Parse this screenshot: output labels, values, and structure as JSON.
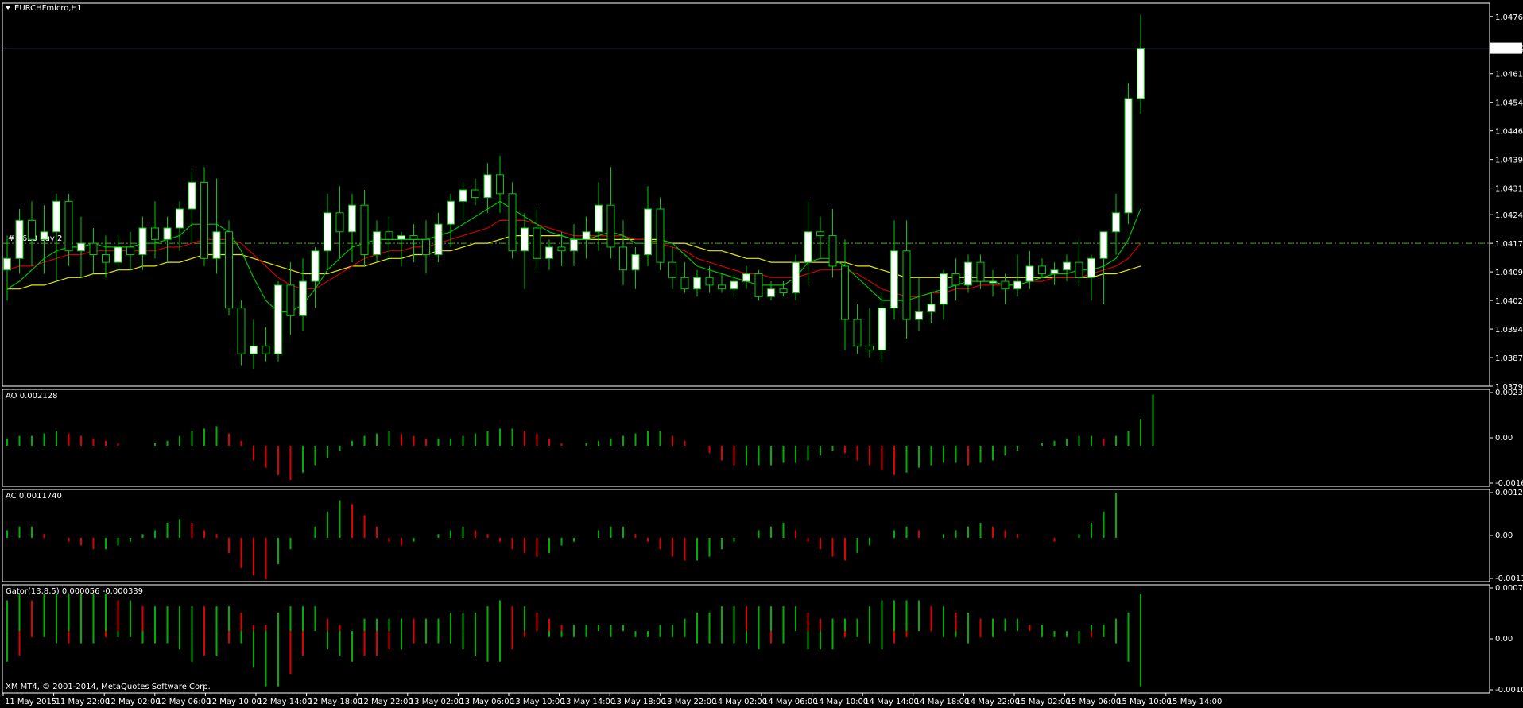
{
  "window": {
    "symbol_title": "EURCHFmicro,H1",
    "copyright": "XM MT4, © 2001-2014, MetaQuotes Software Corp.",
    "order_label": "#  2628  buy  2"
  },
  "colors": {
    "background": "#000000",
    "grid_frame": "#ffffff",
    "bull_body": "#ffffff",
    "wick": "#00cc00",
    "ma_green": "#00c000",
    "ma_red": "#d00000",
    "ma_yellow": "#e8e800",
    "hist_up": "#00b000",
    "hist_down": "#e00000",
    "order_line": "#4cb000",
    "current_price_line": "#a0a8c0"
  },
  "price_axis": {
    "ticks": [
      "1.04765",
      "1.04615",
      "1.04540",
      "1.04465",
      "1.04390",
      "1.04315",
      "1.04245",
      "1.04170",
      "1.04095",
      "1.04020",
      "1.03945",
      "1.03870",
      "1.03795"
    ],
    "current_price": "1.04682",
    "order_price": "1.04170"
  },
  "time_axis": {
    "labels": [
      "11 May 2015",
      "11 May 22:00",
      "12 May 02:00",
      "12 May 06:00",
      "12 May 10:00",
      "12 May 14:00",
      "12 May 18:00",
      "12 May 22:00",
      "13 May 02:00",
      "13 May 06:00",
      "13 May 10:00",
      "13 May 14:00",
      "13 May 18:00",
      "13 May 22:00",
      "14 May 02:00",
      "14 May 06:00",
      "14 May 10:00",
      "14 May 14:00",
      "14 May 18:00",
      "14 May 22:00",
      "15 May 02:00",
      "15 May 06:00",
      "15 May 10:00",
      "15 May 14:00"
    ]
  },
  "panels": {
    "ao": {
      "label": "AO 0.002128",
      "ticks": [
        "0.002309",
        "0.00",
        "-0.001661"
      ]
    },
    "ac": {
      "label": "AC 0.0011740",
      "ticks": [
        "0.001285",
        "0.00",
        "-0.001161"
      ]
    },
    "gator": {
      "label": "Gator(13,8,5) 0.000056 -0.000339",
      "ticks": [
        "0.000752",
        "0.00",
        "-0.001008"
      ]
    }
  },
  "chart_data": {
    "type": "candlestick",
    "title": "EURCHFmicro,H1",
    "timeframe": "H1",
    "ylim": [
      1.03795,
      1.048
    ],
    "candles": [
      [
        1.041,
        1.0419,
        1.0402,
        1.0413
      ],
      [
        1.0413,
        1.0426,
        1.0409,
        1.0423
      ],
      [
        1.0423,
        1.0428,
        1.0411,
        1.0418
      ],
      [
        1.0418,
        1.0427,
        1.0409,
        1.042
      ],
      [
        1.042,
        1.043,
        1.0407,
        1.0428
      ],
      [
        1.0428,
        1.043,
        1.0411,
        1.0415
      ],
      [
        1.0415,
        1.0424,
        1.0408,
        1.0417
      ],
      [
        1.0417,
        1.0421,
        1.0409,
        1.0414
      ],
      [
        1.0414,
        1.0419,
        1.0408,
        1.0412
      ],
      [
        1.0412,
        1.0419,
        1.041,
        1.0416
      ],
      [
        1.0416,
        1.042,
        1.041,
        1.0414
      ],
      [
        1.0414,
        1.0424,
        1.041,
        1.0421
      ],
      [
        1.0421,
        1.0428,
        1.0413,
        1.0418
      ],
      [
        1.0418,
        1.0424,
        1.0412,
        1.0421
      ],
      [
        1.0421,
        1.0428,
        1.0415,
        1.0426
      ],
      [
        1.0426,
        1.0436,
        1.0417,
        1.0433
      ],
      [
        1.0433,
        1.0437,
        1.0411,
        1.0413
      ],
      [
        1.0413,
        1.0434,
        1.0409,
        1.042
      ],
      [
        1.042,
        1.0423,
        1.0398,
        1.04
      ],
      [
        1.04,
        1.0402,
        1.0385,
        1.0388
      ],
      [
        1.0388,
        1.0397,
        1.0384,
        1.039
      ],
      [
        1.039,
        1.0395,
        1.0386,
        1.0388
      ],
      [
        1.0388,
        1.0407,
        1.0386,
        1.0406
      ],
      [
        1.0406,
        1.0412,
        1.0393,
        1.0398
      ],
      [
        1.0398,
        1.0413,
        1.0394,
        1.0407
      ],
      [
        1.0407,
        1.0416,
        1.04,
        1.0415
      ],
      [
        1.0415,
        1.043,
        1.041,
        1.0425
      ],
      [
        1.0425,
        1.0432,
        1.0413,
        1.042
      ],
      [
        1.042,
        1.043,
        1.0412,
        1.0427
      ],
      [
        1.0427,
        1.0431,
        1.0411,
        1.0414
      ],
      [
        1.0414,
        1.0423,
        1.0412,
        1.042
      ],
      [
        1.042,
        1.0424,
        1.0412,
        1.0418
      ],
      [
        1.0418,
        1.042,
        1.0411,
        1.0419
      ],
      [
        1.0419,
        1.0422,
        1.0412,
        1.0418
      ],
      [
        1.0418,
        1.0423,
        1.0409,
        1.0414
      ],
      [
        1.0414,
        1.0425,
        1.0412,
        1.0422
      ],
      [
        1.0422,
        1.043,
        1.0416,
        1.0428
      ],
      [
        1.0428,
        1.0433,
        1.0423,
        1.0431
      ],
      [
        1.0431,
        1.0434,
        1.0427,
        1.0429
      ],
      [
        1.0429,
        1.0438,
        1.0425,
        1.0435
      ],
      [
        1.0435,
        1.044,
        1.0425,
        1.043
      ],
      [
        1.043,
        1.0433,
        1.0413,
        1.0415
      ],
      [
        1.0415,
        1.0425,
        1.0405,
        1.0421
      ],
      [
        1.0421,
        1.0426,
        1.041,
        1.0413
      ],
      [
        1.0413,
        1.0418,
        1.041,
        1.0416
      ],
      [
        1.0416,
        1.042,
        1.0411,
        1.0415
      ],
      [
        1.0415,
        1.0422,
        1.0411,
        1.0418
      ],
      [
        1.0418,
        1.0424,
        1.0413,
        1.042
      ],
      [
        1.042,
        1.0433,
        1.0415,
        1.0427
      ],
      [
        1.0427,
        1.0437,
        1.0413,
        1.0416
      ],
      [
        1.0416,
        1.0423,
        1.0406,
        1.041
      ],
      [
        1.041,
        1.0416,
        1.0405,
        1.0414
      ],
      [
        1.0414,
        1.0432,
        1.0411,
        1.0426
      ],
      [
        1.0426,
        1.0429,
        1.041,
        1.0412
      ],
      [
        1.0412,
        1.0416,
        1.0405,
        1.0408
      ],
      [
        1.0408,
        1.0412,
        1.0404,
        1.0405
      ],
      [
        1.0405,
        1.041,
        1.0403,
        1.0408
      ],
      [
        1.0408,
        1.0411,
        1.0404,
        1.0406
      ],
      [
        1.0406,
        1.0409,
        1.0404,
        1.0405
      ],
      [
        1.0405,
        1.0409,
        1.0403,
        1.0407
      ],
      [
        1.0407,
        1.0411,
        1.0405,
        1.0409
      ],
      [
        1.0409,
        1.041,
        1.0402,
        1.0403
      ],
      [
        1.0403,
        1.0407,
        1.0402,
        1.0405
      ],
      [
        1.0405,
        1.0407,
        1.0403,
        1.0404
      ],
      [
        1.0404,
        1.0414,
        1.0402,
        1.0412
      ],
      [
        1.0412,
        1.0428,
        1.0406,
        1.042
      ],
      [
        1.042,
        1.0424,
        1.0413,
        1.0419
      ],
      [
        1.0419,
        1.0426,
        1.0408,
        1.0411
      ],
      [
        1.0411,
        1.0418,
        1.0389,
        1.0397
      ],
      [
        1.0397,
        1.0401,
        1.0388,
        1.039
      ],
      [
        1.039,
        1.04,
        1.0387,
        1.0389
      ],
      [
        1.0389,
        1.0404,
        1.0386,
        1.04
      ],
      [
        1.04,
        1.0423,
        1.0397,
        1.0415
      ],
      [
        1.0415,
        1.0423,
        1.0392,
        1.0397
      ],
      [
        1.0397,
        1.0408,
        1.0394,
        1.0399
      ],
      [
        1.0399,
        1.0404,
        1.0396,
        1.0401
      ],
      [
        1.0401,
        1.041,
        1.0397,
        1.0409
      ],
      [
        1.0409,
        1.0413,
        1.0402,
        1.0406
      ],
      [
        1.0406,
        1.0414,
        1.0404,
        1.0412
      ],
      [
        1.0412,
        1.0414,
        1.0405,
        1.0407
      ],
      [
        1.0407,
        1.041,
        1.0403,
        1.0407
      ],
      [
        1.0407,
        1.0409,
        1.0401,
        1.0405
      ],
      [
        1.0405,
        1.0414,
        1.0403,
        1.0407
      ],
      [
        1.0407,
        1.0415,
        1.0405,
        1.0411
      ],
      [
        1.0411,
        1.0413,
        1.0408,
        1.0409
      ],
      [
        1.0409,
        1.0412,
        1.0406,
        1.041
      ],
      [
        1.041,
        1.0414,
        1.0407,
        1.0412
      ],
      [
        1.0412,
        1.0418,
        1.0406,
        1.0408
      ],
      [
        1.0408,
        1.0414,
        1.0402,
        1.0413
      ],
      [
        1.0413,
        1.042,
        1.0401,
        1.042
      ],
      [
        1.042,
        1.043,
        1.0414,
        1.0425
      ],
      [
        1.0425,
        1.0459,
        1.0422,
        1.0455
      ],
      [
        1.0455,
        1.0477,
        1.0451,
        1.0468
      ]
    ],
    "ma_green": [
      1.0405,
      1.0407,
      1.041,
      1.0413,
      1.0415,
      1.0416,
      1.0416,
      1.0417,
      1.0416,
      1.0416,
      1.0416,
      1.0417,
      1.0417,
      1.0418,
      1.0419,
      1.0422,
      1.0422,
      1.0422,
      1.042,
      1.0415,
      1.0408,
      1.0402,
      1.0399,
      1.0399,
      1.0401,
      1.0405,
      1.041,
      1.0413,
      1.0416,
      1.0417,
      1.0418,
      1.0418,
      1.0418,
      1.0418,
      1.0418,
      1.0419,
      1.042,
      1.0422,
      1.0424,
      1.0426,
      1.0428,
      1.0426,
      1.0424,
      1.0422,
      1.042,
      1.0419,
      1.0418,
      1.0418,
      1.0419,
      1.042,
      1.0419,
      1.0417,
      1.0417,
      1.0418,
      1.0417,
      1.0414,
      1.0411,
      1.041,
      1.0409,
      1.0408,
      1.0407,
      1.0406,
      1.0406,
      1.0406,
      1.0408,
      1.0412,
      1.0413,
      1.0413,
      1.0411,
      1.0408,
      1.0405,
      1.0402,
      1.0402,
      1.0402,
      1.0403,
      1.0404,
      1.0405,
      1.0406,
      1.0407,
      1.0407,
      1.0407,
      1.0406,
      1.0406,
      1.0407,
      1.0408,
      1.0409,
      1.0409,
      1.041,
      1.041,
      1.0411,
      1.0413,
      1.0418,
      1.0426
    ],
    "ma_red": [
      1.041,
      1.0411,
      1.0411,
      1.0412,
      1.0413,
      1.0414,
      1.0414,
      1.0415,
      1.0415,
      1.0415,
      1.0415,
      1.0415,
      1.0415,
      1.0416,
      1.0416,
      1.0417,
      1.0418,
      1.0418,
      1.0418,
      1.0417,
      1.0414,
      1.0411,
      1.0408,
      1.0406,
      1.0405,
      1.0405,
      1.0407,
      1.0409,
      1.0411,
      1.0413,
      1.0414,
      1.0415,
      1.0415,
      1.0416,
      1.0416,
      1.0417,
      1.0418,
      1.0419,
      1.042,
      1.0421,
      1.0423,
      1.0423,
      1.0423,
      1.0422,
      1.0421,
      1.042,
      1.0419,
      1.0419,
      1.0419,
      1.0419,
      1.0419,
      1.0418,
      1.0418,
      1.0417,
      1.0416,
      1.0415,
      1.0413,
      1.0412,
      1.0411,
      1.041,
      1.0409,
      1.0409,
      1.0408,
      1.0408,
      1.0408,
      1.0409,
      1.041,
      1.041,
      1.041,
      1.0409,
      1.0407,
      1.0405,
      1.0404,
      1.0403,
      1.0403,
      1.0404,
      1.0404,
      1.0405,
      1.0405,
      1.0406,
      1.0406,
      1.0406,
      1.0406,
      1.0407,
      1.0407,
      1.0408,
      1.0408,
      1.0408,
      1.0409,
      1.041,
      1.0411,
      1.0413,
      1.0417
    ],
    "ma_yellow": [
      1.0405,
      1.0405,
      1.0406,
      1.0406,
      1.0407,
      1.0408,
      1.0408,
      1.0409,
      1.0409,
      1.041,
      1.041,
      1.0411,
      1.0411,
      1.0412,
      1.0412,
      1.0413,
      1.0414,
      1.0414,
      1.0414,
      1.0414,
      1.0413,
      1.0412,
      1.0411,
      1.041,
      1.0409,
      1.0409,
      1.0409,
      1.041,
      1.0411,
      1.0411,
      1.0412,
      1.0413,
      1.0413,
      1.0414,
      1.0414,
      1.0415,
      1.0415,
      1.0416,
      1.0417,
      1.0417,
      1.0418,
      1.0419,
      1.0419,
      1.0419,
      1.0419,
      1.0419,
      1.0418,
      1.0418,
      1.0418,
      1.0418,
      1.0418,
      1.0418,
      1.0418,
      1.0418,
      1.0417,
      1.0417,
      1.0416,
      1.0415,
      1.0415,
      1.0414,
      1.0413,
      1.0413,
      1.0412,
      1.0412,
      1.0412,
      1.0412,
      1.0412,
      1.0412,
      1.0412,
      1.0411,
      1.0411,
      1.041,
      1.0409,
      1.0408,
      1.0408,
      1.0408,
      1.0408,
      1.0408,
      1.0408,
      1.0408,
      1.0408,
      1.0408,
      1.0408,
      1.0408,
      1.0408,
      1.0408,
      1.0408,
      1.0408,
      1.0408,
      1.0409,
      1.0409,
      1.041,
      1.0411
    ],
    "ao": [
      0.0003,
      0.0004,
      0.0004,
      0.0005,
      0.0006,
      0.0005,
      0.0004,
      0.0003,
      0.0002,
      0.0001,
      0.0,
      0.0,
      0.0001,
      0.0002,
      0.0004,
      0.0006,
      0.0007,
      0.0008,
      0.0005,
      0.0002,
      -0.0006,
      -0.0009,
      -0.0012,
      -0.0014,
      -0.0011,
      -0.0008,
      -0.0005,
      -0.0002,
      0.0002,
      0.0004,
      0.0005,
      0.0006,
      0.0005,
      0.0004,
      0.0003,
      0.0003,
      0.0003,
      0.0004,
      0.0005,
      0.0006,
      0.0007,
      0.0007,
      0.0006,
      0.0005,
      0.0003,
      0.0001,
      0.0,
      0.0001,
      0.0002,
      0.0003,
      0.0004,
      0.0005,
      0.0006,
      0.0006,
      0.0004,
      0.0002,
      0.0,
      -0.0003,
      -0.0006,
      -0.0008,
      -0.0008,
      -0.0008,
      -0.0008,
      -0.0007,
      -0.0007,
      -0.0006,
      -0.0004,
      -0.0002,
      -0.0003,
      -0.0006,
      -0.0008,
      -0.001,
      -0.0012,
      -0.0011,
      -0.0009,
      -0.0008,
      -0.0007,
      -0.0007,
      -0.0008,
      -0.0007,
      -0.0006,
      -0.0004,
      -0.0002,
      0.0,
      0.0001,
      0.0002,
      0.0003,
      0.0004,
      0.0004,
      0.0003,
      0.0004,
      0.0006,
      0.0011,
      0.0021
    ],
    "ac": [
      0.0002,
      0.0003,
      0.0003,
      0.0001,
      0.0,
      -0.0001,
      -0.0002,
      -0.0003,
      -0.0003,
      -0.0002,
      -0.0001,
      0.0001,
      0.0002,
      0.0004,
      0.0005,
      0.0004,
      0.0002,
      0.0001,
      -0.0004,
      -0.0008,
      -0.001,
      -0.0011,
      -0.0007,
      -0.0003,
      0.0,
      0.0003,
      0.0007,
      0.001,
      0.0009,
      0.0006,
      0.0003,
      -0.0001,
      -0.0002,
      -0.0001,
      0.0,
      0.0001,
      0.0002,
      0.0003,
      0.0002,
      0.0001,
      -0.0001,
      -0.0003,
      -0.0004,
      -0.0005,
      -0.0004,
      -0.0002,
      -0.0001,
      0.0,
      0.0002,
      0.0003,
      0.0003,
      0.0001,
      -0.0001,
      -0.0003,
      -0.0005,
      -0.0006,
      -0.0006,
      -0.0005,
      -0.0003,
      -0.0001,
      0.0,
      0.0002,
      0.0003,
      0.0004,
      0.0002,
      -0.0001,
      -0.0003,
      -0.0005,
      -0.0006,
      -0.0004,
      -0.0002,
      0.0,
      0.0002,
      0.0003,
      0.0002,
      0.0,
      0.0001,
      0.0002,
      0.0003,
      0.0004,
      0.0003,
      0.0002,
      0.0001,
      0.0,
      0.0,
      -0.0001,
      0.0,
      0.0001,
      0.0004,
      0.0007,
      0.0012
    ]
  }
}
